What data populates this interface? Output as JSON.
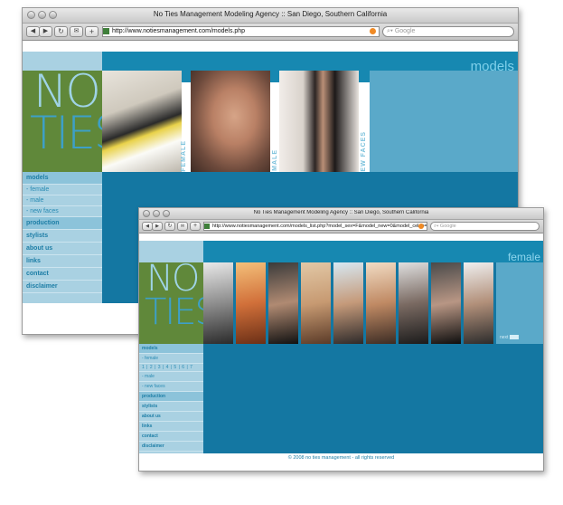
{
  "colors": {
    "teal": "#1788b1",
    "dark_teal": "#1477a2",
    "light_blue": "#a9d1e2",
    "logo_green": "#60883a",
    "nav_text": "#1d7ea6"
  },
  "window1": {
    "title": "No Ties Management Modeling Agency :: San Diego, Southern California",
    "url": "http://www.notiesmanagement.com/models.php",
    "search_placeholder": "Google",
    "page_heading": "models",
    "logo_top": "NO",
    "logo_bottom": "TIES",
    "photo_labels": [
      "FEMALE",
      "MALE",
      "NEW FACES"
    ],
    "nav": [
      {
        "label": "models",
        "type": "section"
      },
      {
        "label": "- female",
        "type": "sub"
      },
      {
        "label": "- male",
        "type": "sub"
      },
      {
        "label": "- new faces",
        "type": "sub"
      },
      {
        "label": "production",
        "type": "section"
      },
      {
        "label": "stylists",
        "type": "section"
      },
      {
        "label": "about us",
        "type": "section"
      },
      {
        "label": "links",
        "type": "section"
      },
      {
        "label": "contact",
        "type": "section"
      },
      {
        "label": "disclaimer",
        "type": "section"
      }
    ]
  },
  "window2": {
    "title": "No Ties Management Modeling Agency :: San Diego, Southern California",
    "url": "http://www.notiesmanagement.com/models_list.php?model_sex=F&model_new=0&model_celeb=",
    "search_placeholder": "Google",
    "page_heading": "female",
    "logo_top": "NO",
    "logo_bottom": "TIES",
    "next_label": "next",
    "pager": "1 | 2 | 3 | 4 | 5 | 6 | 7",
    "footer": "© 2008 no ties management - all rights reserved",
    "nav": [
      {
        "label": "models",
        "type": "section"
      },
      {
        "label": "- female",
        "type": "sub"
      },
      {
        "label": "1 | 2 | 3 | 4 | 5 | 6 | 7",
        "type": "pager"
      },
      {
        "label": "- male",
        "type": "sub"
      },
      {
        "label": "- new faces",
        "type": "sub"
      },
      {
        "label": "production",
        "type": "section"
      },
      {
        "label": "stylists",
        "type": "section"
      },
      {
        "label": "about us",
        "type": "section"
      },
      {
        "label": "links",
        "type": "section"
      },
      {
        "label": "contact",
        "type": "section"
      },
      {
        "label": "disclaimer",
        "type": "section"
      }
    ],
    "thumb_count": 9
  }
}
